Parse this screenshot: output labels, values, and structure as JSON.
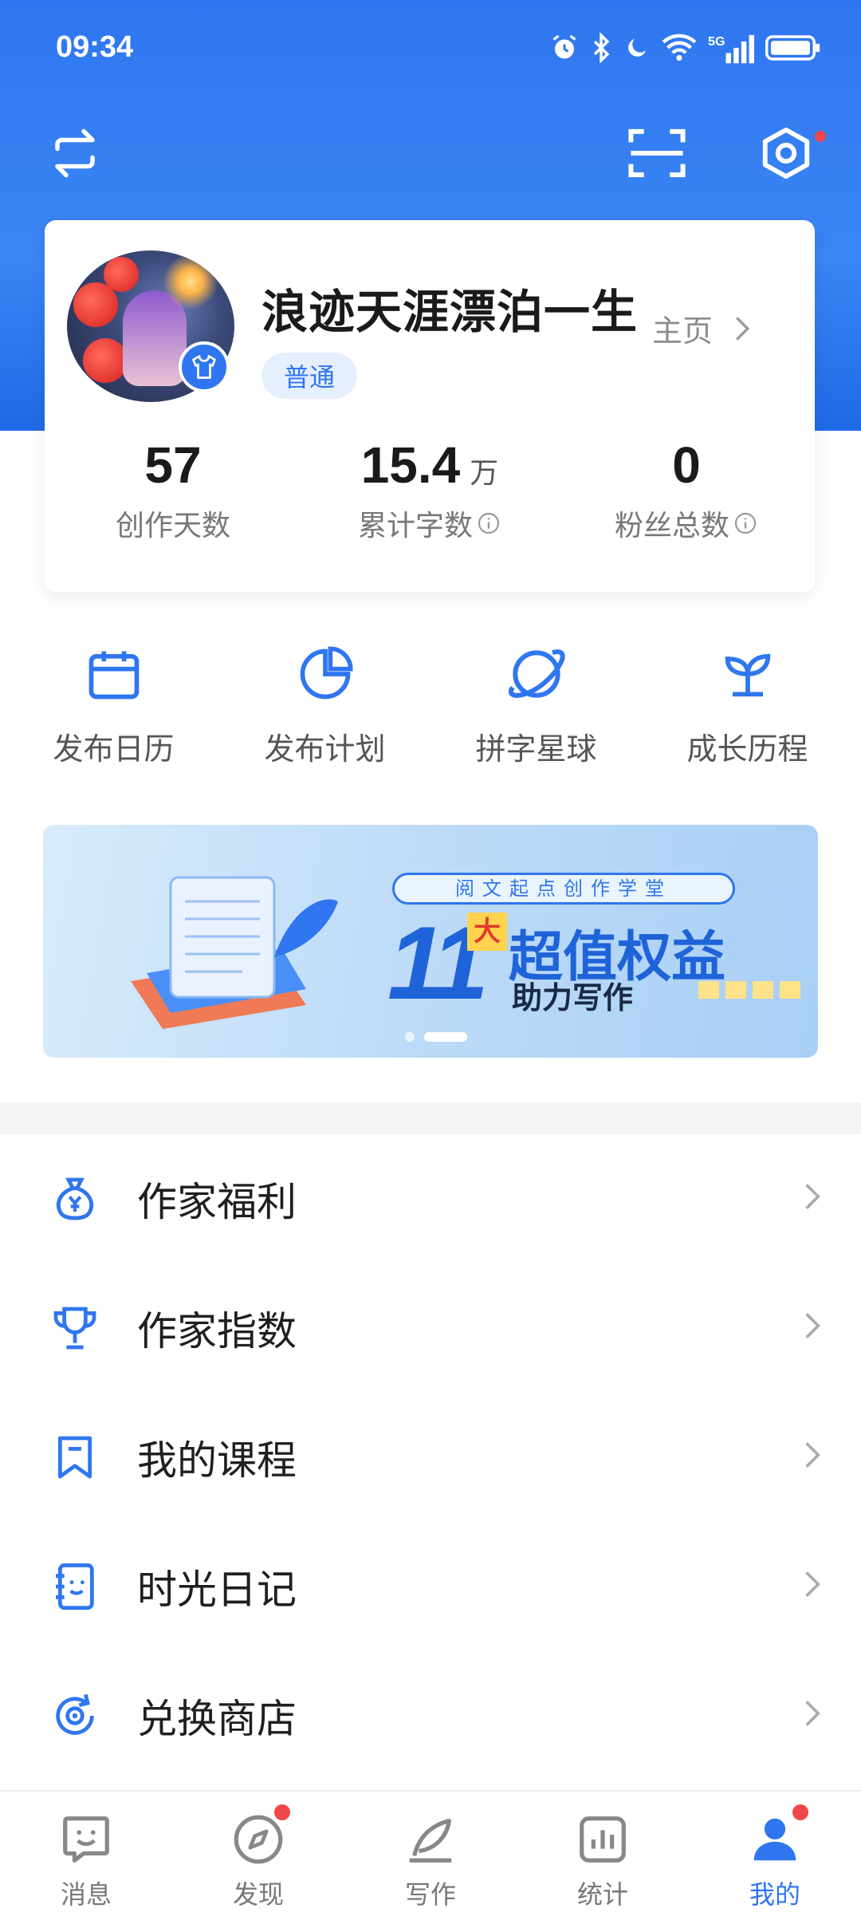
{
  "status_bar": {
    "time": "09:34",
    "icons": [
      "alarm-icon",
      "bluetooth-icon",
      "moon-icon",
      "wifi-icon",
      "signal-5g-icon",
      "battery-icon"
    ]
  },
  "header": {
    "switch_icon": "switch-icon",
    "scan_icon": "scan-icon",
    "settings_icon": "settings-icon",
    "settings_badge": true
  },
  "profile": {
    "name": "浪迹天涯漂泊一生",
    "homepage_label": "主页",
    "level": "普通",
    "stats": [
      {
        "value": "57",
        "unit": "",
        "label": "创作天数",
        "info": false
      },
      {
        "value": "15.4",
        "unit": "万",
        "label": "累计字数",
        "info": true
      },
      {
        "value": "0",
        "unit": "",
        "label": "粉丝总数",
        "info": true
      }
    ]
  },
  "quick_actions": [
    {
      "label": "发布日历",
      "icon": "calendar-icon"
    },
    {
      "label": "发布计划",
      "icon": "pie-chart-icon"
    },
    {
      "label": "拼字星球",
      "icon": "planet-icon"
    },
    {
      "label": "成长历程",
      "icon": "sprout-icon"
    }
  ],
  "banner": {
    "subtitle": "阅文起点创作学堂",
    "number": "11",
    "da": "大",
    "title": "超值权益",
    "tagline": "助力写作",
    "pages": 2,
    "active_page": 2
  },
  "menu": [
    {
      "label": "作家福利",
      "icon": "money-bag-icon"
    },
    {
      "label": "作家指数",
      "icon": "trophy-icon"
    },
    {
      "label": "我的课程",
      "icon": "bookmark-icon"
    },
    {
      "label": "时光日记",
      "icon": "diary-icon"
    },
    {
      "label": "兑换商店",
      "icon": "exchange-icon"
    }
  ],
  "bottom_nav": [
    {
      "label": "消息",
      "icon": "message-icon",
      "badge": false,
      "active": false
    },
    {
      "label": "发现",
      "icon": "compass-icon",
      "badge": true,
      "active": false
    },
    {
      "label": "写作",
      "icon": "pen-icon",
      "badge": false,
      "active": false
    },
    {
      "label": "统计",
      "icon": "stats-icon",
      "badge": false,
      "active": false
    },
    {
      "label": "我的",
      "icon": "person-icon",
      "badge": true,
      "active": true
    }
  ],
  "colors": {
    "primary": "#2f76f0",
    "badge_red": "#f2464a",
    "text_dark": "#1f1f1f",
    "text_gray": "#777777"
  }
}
